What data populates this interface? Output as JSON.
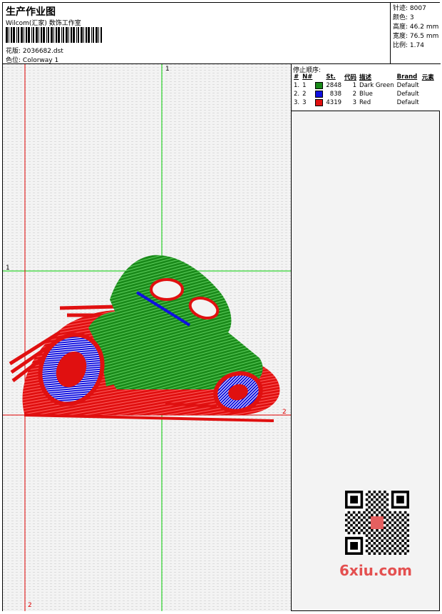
{
  "header": {
    "title": "生产作业图",
    "company": "Wilcom(汇家) 数饰工作室",
    "design_label": "花版:",
    "design_value": "2036682.dst",
    "colorway_label": "色位:",
    "colorway_value": "Colorway 1"
  },
  "stats": [
    {
      "label": "针迹:",
      "value": "8007"
    },
    {
      "label": "颜色:",
      "value": "3"
    },
    {
      "label": "高度:",
      "value": "46.2 mm"
    },
    {
      "label": "宽度:",
      "value": "76.5 mm"
    },
    {
      "label": "比例:",
      "value": "1.74"
    }
  ],
  "stop_sequence": {
    "title": "停止顺序:",
    "columns": [
      "#",
      "N#",
      "St.",
      "代码",
      "描述",
      "Brand",
      "元素"
    ],
    "rows": [
      {
        "index": "1.",
        "n": "1",
        "color": "#1a8a1a",
        "stitches": "2848",
        "code": "1",
        "desc": "Dark Green",
        "brand": "Default"
      },
      {
        "index": "2.",
        "n": "2",
        "color": "#1010e0",
        "stitches": "838",
        "code": "2",
        "desc": "Blue",
        "brand": "Default"
      },
      {
        "index": "3.",
        "n": "3",
        "color": "#e01010",
        "stitches": "4319",
        "code": "3",
        "desc": "Red",
        "brand": "Default"
      }
    ]
  },
  "axes": {
    "label_1": "1",
    "label_2": "2"
  },
  "colors": {
    "green": "#1a8a1a",
    "blue": "#1010e0",
    "red": "#e01010",
    "guide_green": "#00cc00",
    "guide_red": "#e00000"
  },
  "watermark": {
    "text": "6xiu.com"
  }
}
